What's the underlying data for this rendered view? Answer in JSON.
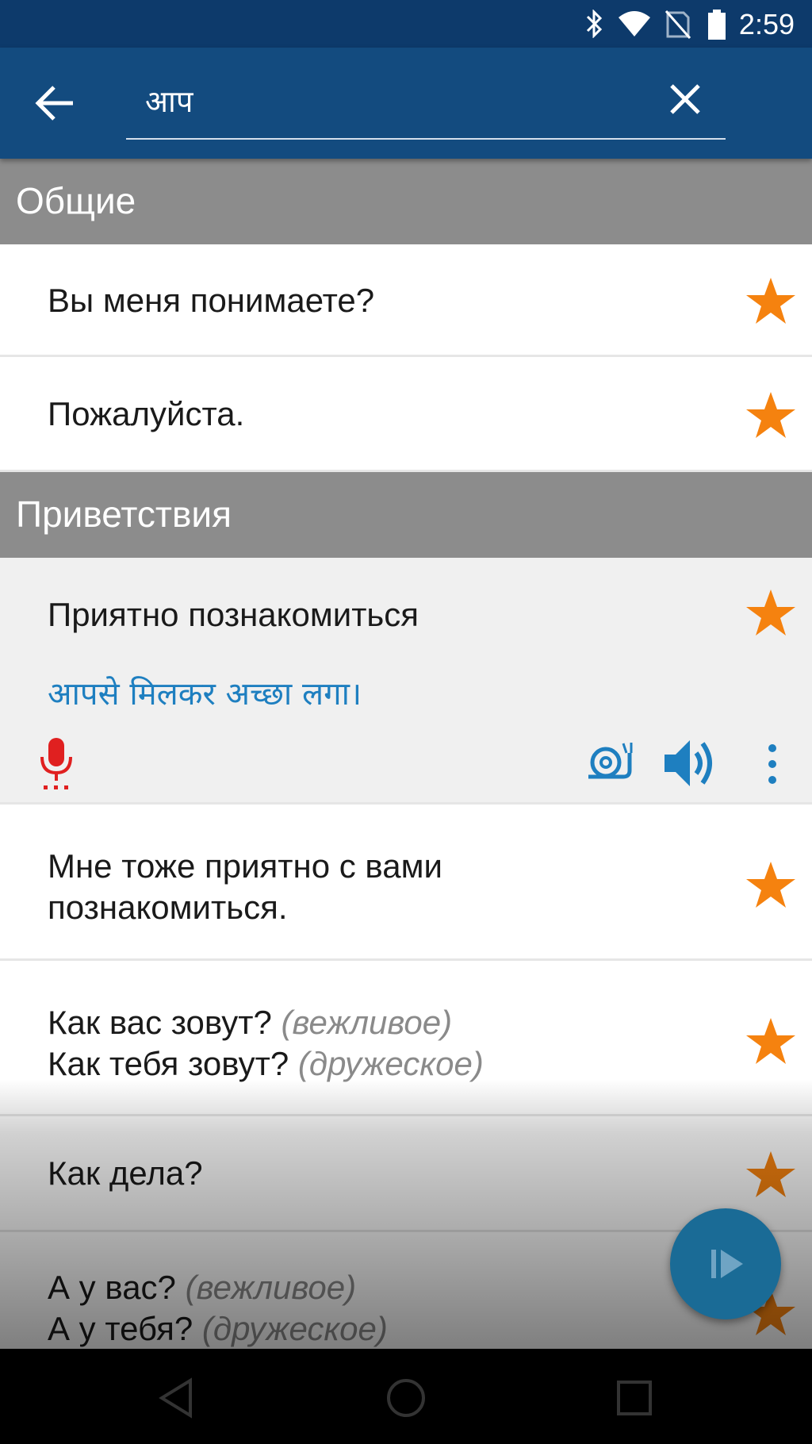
{
  "status_bar": {
    "time": "2:59",
    "icons": [
      "bluetooth-icon",
      "wifi-icon",
      "no-sim-icon",
      "battery-icon"
    ]
  },
  "app_bar": {
    "back_icon": "arrow-left-icon",
    "search_value": "आप",
    "clear_icon": "close-icon"
  },
  "sections": [
    {
      "title": "Общие",
      "items": [
        {
          "lines": [
            {
              "text": "Вы меня понимаете?",
              "note": ""
            }
          ],
          "favorite": true
        },
        {
          "lines": [
            {
              "text": "Пожалуйста.",
              "note": ""
            }
          ],
          "favorite": true
        }
      ]
    },
    {
      "title": "Приветствия",
      "items": [
        {
          "lines": [
            {
              "text": "Приятно познакомиться",
              "note": ""
            }
          ],
          "translation": "आपसे मिलकर अच्छा लगा।",
          "favorite": true,
          "expanded": true,
          "actions": [
            "microphone-icon",
            "snail-icon",
            "speaker-icon",
            "more-vertical-icon"
          ]
        },
        {
          "lines": [
            {
              "text": "Мне тоже приятно с вами",
              "note": ""
            },
            {
              "text": "познакомиться.",
              "note": ""
            }
          ],
          "favorite": true
        },
        {
          "lines": [
            {
              "text": "Как вас зовут?",
              "note": "(вежливое)"
            },
            {
              "text": "Как тебя зовут?",
              "note": "(дружеское)"
            }
          ],
          "favorite": true
        },
        {
          "lines": [
            {
              "text": "Как дела?",
              "note": ""
            }
          ],
          "favorite": true
        },
        {
          "lines": [
            {
              "text": "А у вас?",
              "note": "(вежливое)"
            },
            {
              "text": "А у тебя?",
              "note": "(дружеское)"
            }
          ],
          "favorite": true
        }
      ]
    }
  ],
  "fab": {
    "icon": "play-icon"
  },
  "nav_bar": {
    "icons": [
      "back-triangle-icon",
      "home-circle-icon",
      "recents-square-icon"
    ]
  },
  "colors": {
    "status_bar": "#0d3a6b",
    "app_bar": "#134b7f",
    "section_header": "#8c8c8c",
    "star": "#f5820f",
    "translation": "#1e7fc0",
    "mic": "#e02020",
    "fab": "#1a6b96"
  }
}
